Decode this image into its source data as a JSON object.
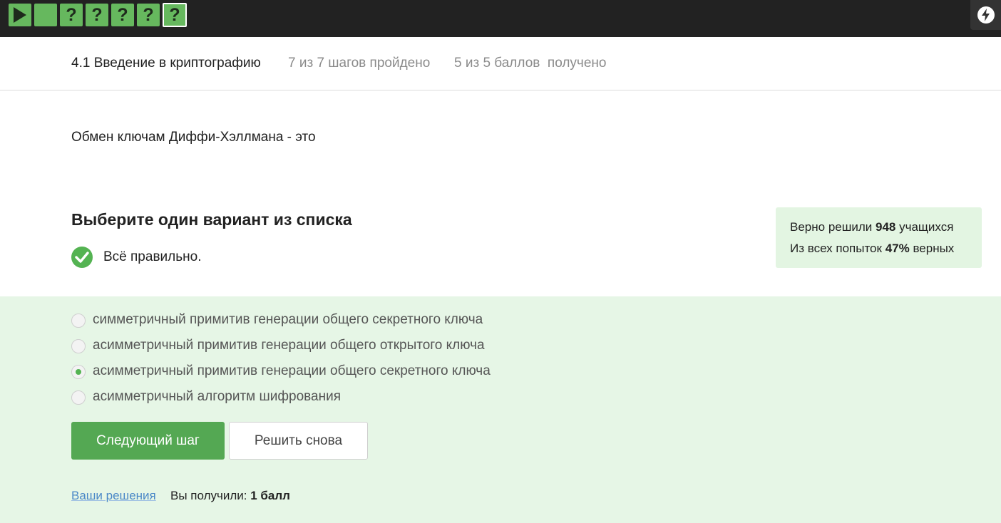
{
  "steps": {
    "items": [
      {
        "type": "video",
        "label": ""
      },
      {
        "type": "text",
        "label": ""
      },
      {
        "type": "quiz",
        "label": "?"
      },
      {
        "type": "quiz",
        "label": "?"
      },
      {
        "type": "quiz",
        "label": "?"
      },
      {
        "type": "quiz",
        "label": "?"
      },
      {
        "type": "quiz",
        "label": "?",
        "current": true
      }
    ],
    "right_icon": "bolt-icon"
  },
  "lesson": {
    "title": "4.1 Введение в криптографию",
    "steps_progress": "7 из 7 шагов пройдено",
    "points_progress": "5 из 5 баллов  получено"
  },
  "question": {
    "text": "Обмен ключам Диффи-Хэллмана - это"
  },
  "answer": {
    "instruction": "Выберите один вариант из списка",
    "result": "Всё правильно.",
    "options": [
      {
        "label": "симметричный примитив генерации общего секретного ключа",
        "selected": false
      },
      {
        "label": "асимметричный примитив генерации общего открытого ключа",
        "selected": false
      },
      {
        "label": "асимметричный примитив генерации общего секретного ключа",
        "selected": true
      },
      {
        "label": "асимметричный алгоритм шифрования",
        "selected": false
      }
    ]
  },
  "stats": {
    "solved_prefix": "Верно решили ",
    "solved_count": "948",
    "solved_suffix": " учащихся",
    "attempts_prefix": "Из всех попыток ",
    "attempts_percent": "47%",
    "attempts_suffix": " верных"
  },
  "actions": {
    "next_label": "Следующий шаг",
    "retry_label": "Решить снова"
  },
  "footer": {
    "solutions_link": "Ваши решения",
    "you_got_prefix": "Вы получили: ",
    "you_got_value": "1 балл"
  },
  "colors": {
    "accent": "#54a853",
    "topbar": "#222222",
    "green_area": "#e6f6e6"
  }
}
